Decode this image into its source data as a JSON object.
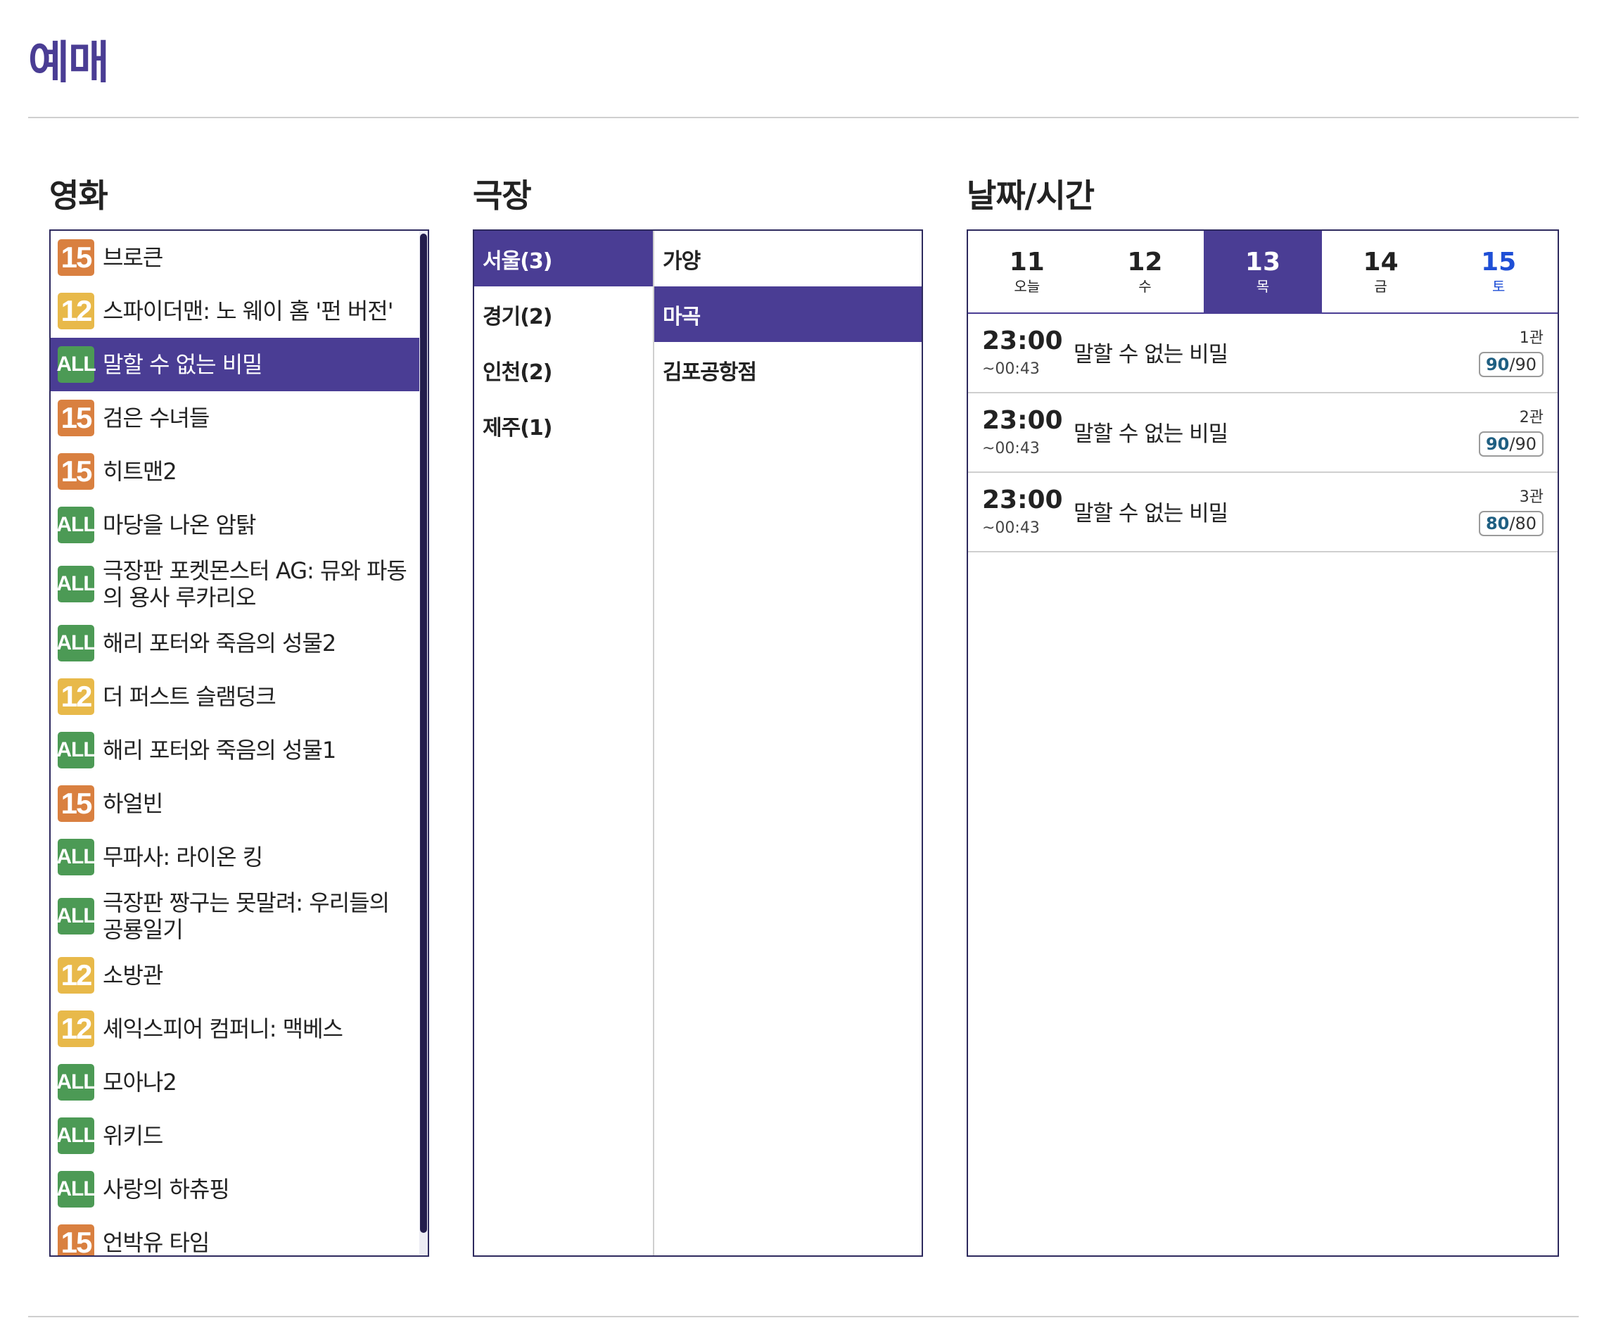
{
  "page_title": "예매",
  "sections": {
    "movie": "영화",
    "theater": "극장",
    "datetime": "날짜/시간"
  },
  "colors": {
    "accent": "#4a3d94",
    "rating_15": "#d98040",
    "rating_12": "#e8b94a",
    "rating_all": "#4c9a55",
    "saturday": "#1f4fd6"
  },
  "movies": [
    {
      "rating": "15",
      "title": "브로큰"
    },
    {
      "rating": "12",
      "title": "스파이더맨: 노 웨이 홈 '펀 버전'"
    },
    {
      "rating": "ALL",
      "title": "말할 수 없는 비밀",
      "selected": true
    },
    {
      "rating": "15",
      "title": "검은 수녀들"
    },
    {
      "rating": "15",
      "title": "히트맨2"
    },
    {
      "rating": "ALL",
      "title": "마당을 나온 암탉"
    },
    {
      "rating": "ALL",
      "title": "극장판 포켓몬스터 AG: 뮤와 파동의 용사 루카리오"
    },
    {
      "rating": "ALL",
      "title": "해리 포터와 죽음의 성물2"
    },
    {
      "rating": "12",
      "title": "더 퍼스트 슬램덩크"
    },
    {
      "rating": "ALL",
      "title": "해리 포터와 죽음의 성물1"
    },
    {
      "rating": "15",
      "title": "하얼빈"
    },
    {
      "rating": "ALL",
      "title": "무파사: 라이온 킹"
    },
    {
      "rating": "ALL",
      "title": "극장판 짱구는 못말려: 우리들의 공룡일기"
    },
    {
      "rating": "12",
      "title": "소방관"
    },
    {
      "rating": "12",
      "title": "셰익스피어 컴퍼니: 맥베스"
    },
    {
      "rating": "ALL",
      "title": "모아나2"
    },
    {
      "rating": "ALL",
      "title": "위키드"
    },
    {
      "rating": "ALL",
      "title": "사랑의 하츄핑"
    },
    {
      "rating": "15",
      "title": "언박유 타임"
    }
  ],
  "regions": [
    {
      "label": "서울(3)",
      "selected": true
    },
    {
      "label": "경기(2)"
    },
    {
      "label": "인천(2)"
    },
    {
      "label": "제주(1)"
    }
  ],
  "branches": [
    {
      "label": "가양"
    },
    {
      "label": "마곡",
      "selected": true
    },
    {
      "label": "김포공항점"
    }
  ],
  "dates": [
    {
      "day": "11",
      "dow": "오늘"
    },
    {
      "day": "12",
      "dow": "수"
    },
    {
      "day": "13",
      "dow": "목",
      "selected": true
    },
    {
      "day": "14",
      "dow": "금"
    },
    {
      "day": "15",
      "dow": "토",
      "saturday": true
    }
  ],
  "showtimes": [
    {
      "start": "23:00",
      "end": "~00:43",
      "title": "말할 수 없는 비밀",
      "screen": "1관",
      "available": "90",
      "total": "/90"
    },
    {
      "start": "23:00",
      "end": "~00:43",
      "title": "말할 수 없는 비밀",
      "screen": "2관",
      "available": "90",
      "total": "/90"
    },
    {
      "start": "23:00",
      "end": "~00:43",
      "title": "말할 수 없는 비밀",
      "screen": "3관",
      "available": "80",
      "total": "/80"
    }
  ]
}
